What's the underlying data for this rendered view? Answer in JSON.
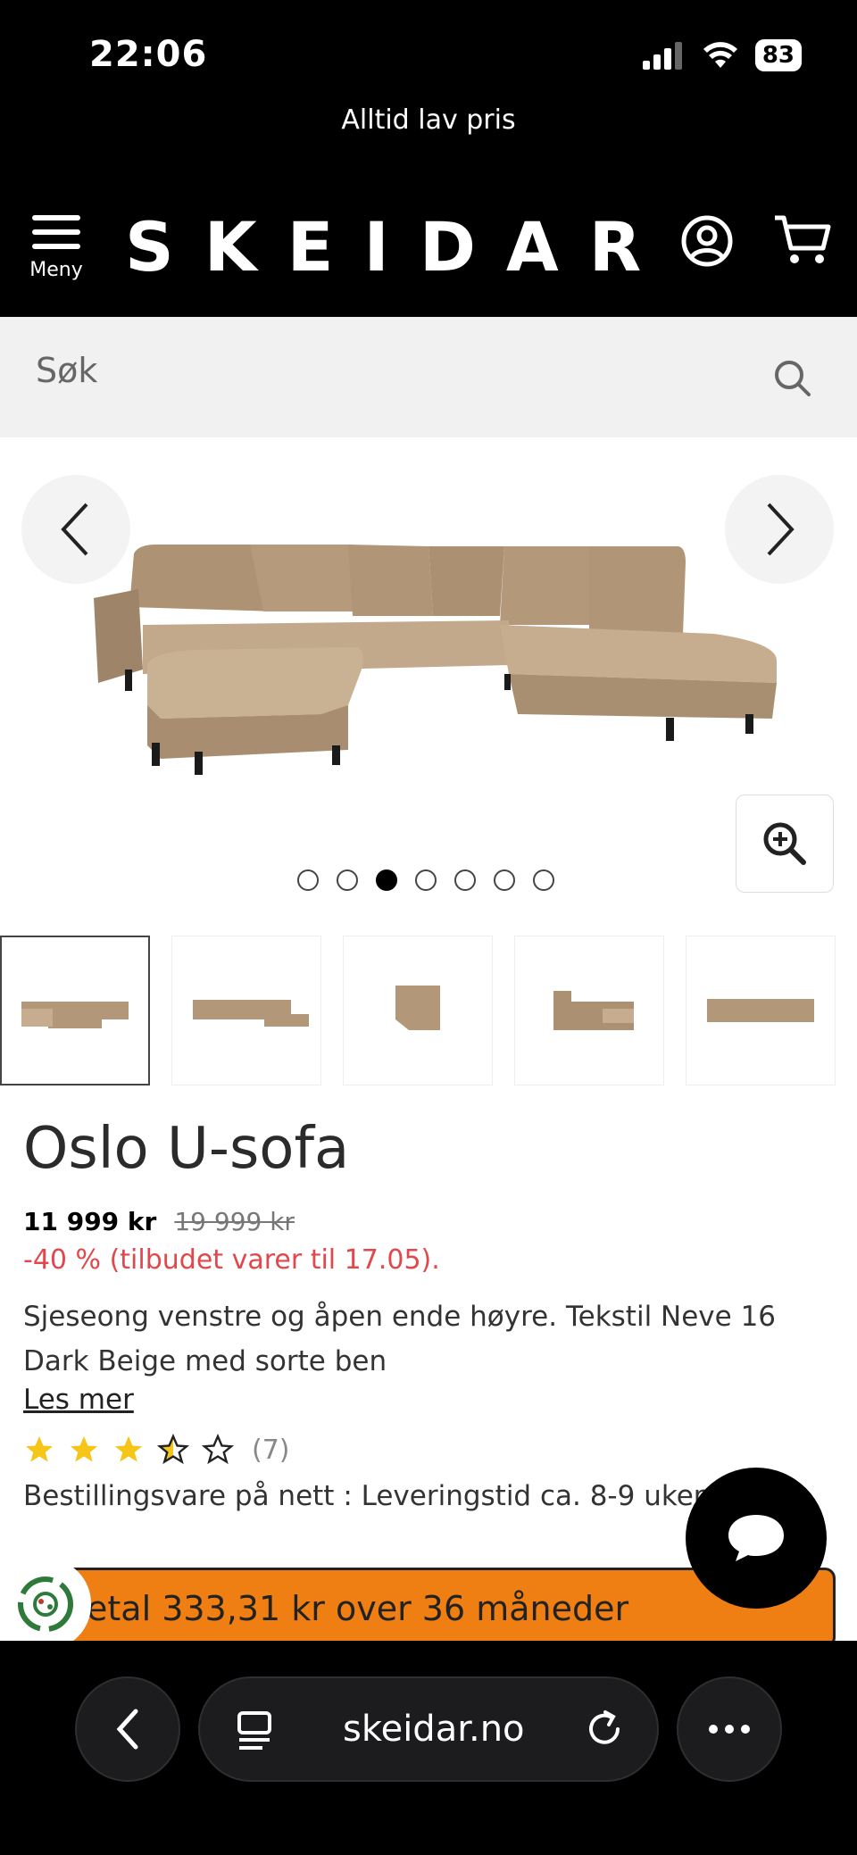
{
  "status_bar": {
    "time": "22:06",
    "battery": "83"
  },
  "promo": {
    "text": "Alltid lav pris"
  },
  "header": {
    "logo": "SKEIDAR",
    "menu_label": "Meny"
  },
  "search": {
    "placeholder": "Søk"
  },
  "product": {
    "title": "Oslo U-sofa",
    "price": "11 999 kr",
    "old_price": "19 999 kr",
    "discount": "-40 % (tilbudet varer til 17.05).",
    "description": "Sjeseong venstre og åpen ende høyre. Tekstil Neve 16 Dark Beige med sorte ben",
    "read_more": "Les mer",
    "rating": 3.5,
    "rating_count": "(7)",
    "delivery": "Bestillingsvare på nett : Leveringstid ca. 8-9 uker",
    "finance_text": "etal 333,31 kr over 36 måneder"
  },
  "gallery": {
    "image_count": 7,
    "active_index": 2
  },
  "browser": {
    "url": "skeidar.no"
  },
  "colors": {
    "accent_orange": "#f07f13",
    "discount_red": "#e2474b",
    "fabric": "#b69a7c"
  }
}
